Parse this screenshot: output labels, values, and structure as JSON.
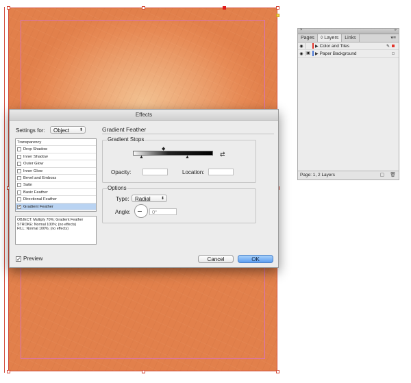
{
  "dialog": {
    "title": "Effects",
    "settings_for_label": "Settings for:",
    "settings_for_value": "Object",
    "effects": [
      {
        "label": "Transparency",
        "checked": false,
        "header": true
      },
      {
        "label": "Drop Shadow",
        "checked": false
      },
      {
        "label": "Inner Shadow",
        "checked": false
      },
      {
        "label": "Outer Glow",
        "checked": false
      },
      {
        "label": "Inner Glow",
        "checked": false
      },
      {
        "label": "Bevel and Emboss",
        "checked": false
      },
      {
        "label": "Satin",
        "checked": false
      },
      {
        "label": "Basic Feather",
        "checked": false
      },
      {
        "label": "Directional Feather",
        "checked": false
      },
      {
        "label": "Gradient Feather",
        "checked": true,
        "selected": true
      }
    ],
    "summary": [
      "OBJECT: Multiply 70%; Gradient Feather",
      "STROKE: Normal 100%; (no effects)",
      "FILL: Normal 100%; (no effects)"
    ],
    "preview_label": "Preview",
    "preview_checked": true,
    "cancel_label": "Cancel",
    "ok_label": "OK",
    "section_title": "Gradient Feather",
    "gradient_stops": {
      "title": "Gradient Stops",
      "opacity_label": "Opacity:",
      "location_label": "Location:"
    },
    "options": {
      "title": "Options",
      "type_label": "Type:",
      "type_value": "Radial",
      "angle_label": "Angle:",
      "angle_value": "0°"
    }
  },
  "layers_panel": {
    "tabs": [
      "Pages",
      "◊ Layers",
      "Links"
    ],
    "active_tab": 1,
    "layers": [
      {
        "name": "Color and Tiles",
        "color": "#e2342a"
      },
      {
        "name": "Paper Background",
        "color": "#4a78d6"
      }
    ],
    "footer_text": "Page: 1, 2 Layers"
  },
  "colors": {
    "page_orange": "#e78a55",
    "frame_red": "#d24a3a",
    "margin_pink": "#d874b5",
    "ok_blue": "#5c9ef0",
    "selected_row": "#b9d3f2"
  }
}
